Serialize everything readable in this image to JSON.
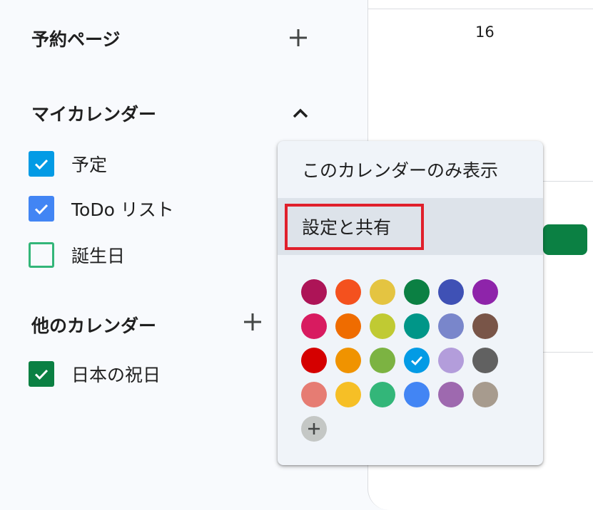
{
  "sidebar": {
    "booking": {
      "title": "予約ページ",
      "action_icon": "plus-icon"
    },
    "my_calendars": {
      "title": "マイカレンダー",
      "action_icon": "chevron-up-icon",
      "items": [
        {
          "label": "予定",
          "checked": true,
          "color": "#039be5"
        },
        {
          "label": "ToDo リスト",
          "checked": true,
          "color": "#4285f4"
        },
        {
          "label": "誕生日",
          "checked": false,
          "color": "#33b679"
        }
      ]
    },
    "other_calendars": {
      "title": "他のカレンダー",
      "action_icon": "plus-icon",
      "items": [
        {
          "label": "日本の祝日",
          "checked": true,
          "color": "#0b8043"
        }
      ]
    }
  },
  "main": {
    "day_number": "16",
    "event_color": "#0b8043"
  },
  "popup": {
    "menu": {
      "show_only": "このカレンダーのみ表示",
      "settings": "設定と共有"
    },
    "highlight_color": "#e0202b",
    "selected_color": "#039be5",
    "colors": [
      [
        "#ad1457",
        "#f4511e",
        "#e4c441",
        "#0b8043",
        "#3f51b5",
        "#8e24aa"
      ],
      [
        "#d81b60",
        "#ef6c00",
        "#c0ca33",
        "#009688",
        "#7986cb",
        "#795548"
      ],
      [
        "#d50000",
        "#f09300",
        "#7cb342",
        "#039be5",
        "#b39ddb",
        "#616161"
      ],
      [
        "#e67c73",
        "#f6bf26",
        "#33b679",
        "#4285f4",
        "#9e69af",
        "#a79b8e"
      ]
    ],
    "add_color_icon": "plus-icon"
  }
}
